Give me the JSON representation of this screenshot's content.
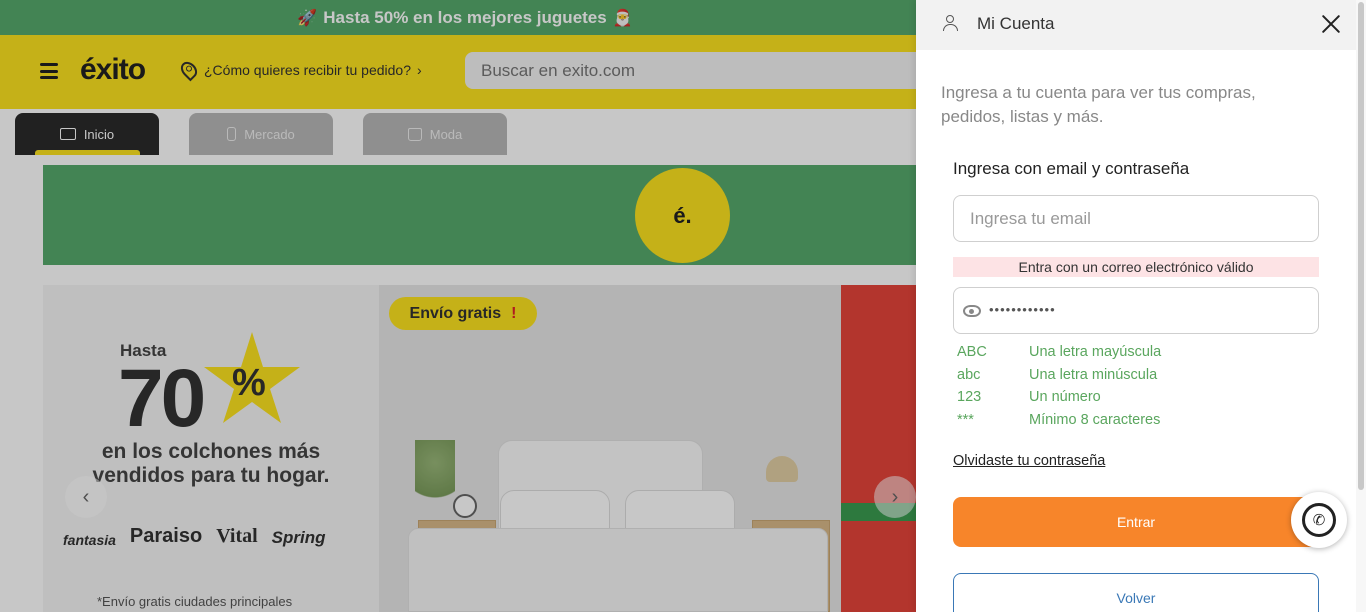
{
  "promo_bar": {
    "rocket_emoji": "🚀",
    "text": "Hasta 50% en los mejores juguetes",
    "santa_emoji": "🎅"
  },
  "header": {
    "logo": "éxito",
    "location_prompt": "¿Cómo quieres recibir tu pedido?",
    "location_chevron": "›",
    "search_placeholder": "Buscar en exito.com"
  },
  "tabs": [
    {
      "label": "Inicio",
      "icon": "monitor-icon",
      "active": true
    },
    {
      "label": "Mercado",
      "icon": "bottle-icon",
      "active": false
    },
    {
      "label": "Moda",
      "icon": "shirt-icon",
      "active": false
    }
  ],
  "banner": {
    "circle_text": "é."
  },
  "carousel": {
    "left_slide": {
      "hasta": "Hasta",
      "big_number": "70",
      "percent": "%",
      "line1": "en los colchones más",
      "line2": "vendidos para tu hogar.",
      "brands": [
        "fantasia",
        "Paraiso",
        "Vital",
        "Spring"
      ],
      "note": "*Envío gratis ciudades principales"
    },
    "mid_slide": {
      "pill_text": "Envío gratis",
      "pill_mark": "!"
    },
    "prev_arrow": "‹",
    "next_arrow": "›"
  },
  "account_panel": {
    "title": "Mi Cuenta",
    "intro": "Ingresa a tu cuenta para ver tus compras, pedidos, listas y más.",
    "subtitle": "Ingresa con email y contraseña",
    "email_placeholder": "Ingresa tu email",
    "error_message": "Entra con un correo electrónico válido",
    "password_mask": "••••••••••••",
    "rules": [
      {
        "key": "ABC",
        "label": "Una letra mayúscula"
      },
      {
        "key": "abc",
        "label": "Una letra minúscula"
      },
      {
        "key": "123",
        "label": "Un número"
      },
      {
        "key": "***",
        "label": "Mínimo 8 caracteres"
      }
    ],
    "forgot_link": "Olvidaste tu contraseña",
    "submit_label": "Entrar",
    "back_label": "Volver"
  },
  "colors": {
    "brand_yellow": "#fde31f",
    "promo_green": "#56a96c",
    "submit_orange": "#f7852a",
    "back_blue": "#3a78b6",
    "rule_green": "#5aa65e",
    "error_bg": "#fde3e5"
  }
}
